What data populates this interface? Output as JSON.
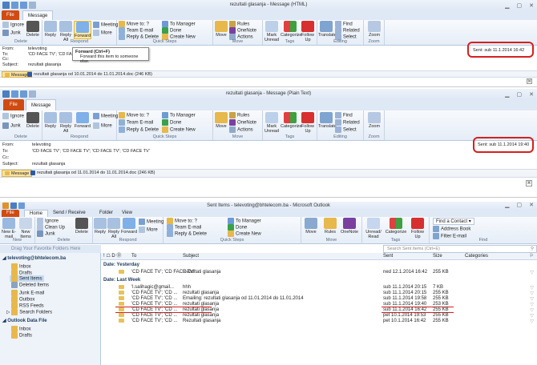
{
  "win1": {
    "title": "rezultati glasanja - Message (HTML)",
    "tabs": [
      "File",
      "Message"
    ],
    "groups": {
      "delete": {
        "label": "Delete",
        "ignore": "Ignore",
        "junk": "Junk",
        "delete": "Delete"
      },
      "respond": {
        "label": "Respond",
        "reply": "Reply",
        "reply_all": "Reply All",
        "forward": "Forward",
        "meeting": "Meeting",
        "more": "More"
      },
      "quick": {
        "label": "Quick Steps",
        "move_to": "Move to: ?",
        "team_email": "Team E-mail",
        "reply_delete": "Reply & Delete",
        "to_manager": "To Manager",
        "done": "Done",
        "create_new": "Create New"
      },
      "move": {
        "label": "Move",
        "move": "Move",
        "rules": "Rules",
        "onenote": "OneNote",
        "actions": "Actions"
      },
      "tags": {
        "label": "Tags",
        "mark_unread": "Mark Unread",
        "categorize": "Categorize",
        "follow_up": "Follow Up"
      },
      "editing": {
        "label": "Editing",
        "translate": "Translate",
        "find": "Find",
        "related": "Related",
        "select": "Select"
      },
      "zoom": {
        "label": "Zoom",
        "zoom": "Zoom"
      }
    },
    "from_label": "From:",
    "from": "televoting",
    "to_label": "To:",
    "to": "'CD FACE TV'; 'CD FACE TV'",
    "cc_label": "Cc:",
    "subject_label": "Subject:",
    "subject": "rezultati glasanja",
    "sent_label": "Sent:",
    "sent": "sub 11.1.2014 16:42",
    "tooltip_title": "Forward (Ctrl+F)",
    "tooltip_desc": "Forward this item to someone else.",
    "message_tab": "Message",
    "attachment": "rezultati glasanja od 10.01.2014 do 11.01.2014.doc (246 KB)"
  },
  "win2": {
    "title": "rezultati glasanja - Message (Plain Text)",
    "tabs": [
      "File",
      "Message"
    ],
    "groups": {
      "delete": {
        "label": "Delete",
        "ignore": "Ignore",
        "junk": "Junk",
        "delete": "Delete"
      },
      "respond": {
        "label": "Respond",
        "reply": "Reply",
        "reply_all": "Reply All",
        "forward": "Forward",
        "meeting": "Meeting",
        "more": "More"
      },
      "quick": {
        "label": "Quick Steps",
        "move_to": "Move to: ?",
        "team_email": "Team E-mail",
        "reply_delete": "Reply & Delete",
        "to_manager": "To Manager",
        "done": "Done",
        "create_new": "Create New"
      },
      "move": {
        "label": "Move",
        "move": "Move",
        "rules": "Rules",
        "onenote": "OneNote",
        "actions": "Actions"
      },
      "tags": {
        "label": "Tags",
        "mark_unread": "Mark Unread",
        "categorize": "Categorize",
        "follow_up": "Follow Up"
      },
      "editing": {
        "label": "Editing",
        "translate": "Translate",
        "find": "Find",
        "related": "Related",
        "select": "Select"
      },
      "zoom": {
        "label": "Zoom",
        "zoom": "Zoom"
      }
    },
    "from_label": "From:",
    "from": "televoting",
    "to_label": "To:",
    "to": "'CD FACE TV'; 'CD FACE TV'; 'CD FACE TV'; 'CD FACE TV'",
    "cc_label": "Cc:",
    "subject_label": "Subject:",
    "subject": "rezultati glasanja",
    "sent_label": "Sent:",
    "sent": "sub 11.1.2014 19:40",
    "message_tab": "Message",
    "attachment": "rezultati glasanja od 11.01.2014 do 11.01.2014.doc (246 KB)"
  },
  "main": {
    "title": "Sent Items - televoting@bhtelecom.ba - Microsoft Outlook",
    "tabs": [
      "File",
      "Home",
      "Send / Receive",
      "Folder",
      "View"
    ],
    "groups": {
      "new": {
        "label": "New",
        "new_email": "New E-mail",
        "new_items": "New Items"
      },
      "delete": {
        "label": "Delete",
        "ignore": "Ignore",
        "clean_up": "Clean Up",
        "junk": "Junk",
        "delete": "Delete"
      },
      "respond": {
        "label": "Respond",
        "reply": "Reply",
        "reply_all": "Reply All",
        "forward": "Forward",
        "meeting": "Meeting",
        "more": "More"
      },
      "quick": {
        "label": "Quick Steps",
        "move_to": "Move to: ?",
        "team_email": "Team E-mail",
        "reply_delete": "Reply & Delete",
        "to_manager": "To Manager",
        "done": "Done",
        "create_new": "Create New"
      },
      "move": {
        "label": "Move",
        "move": "Move",
        "rules": "Rules",
        "onenote": "OneNote"
      },
      "tags": {
        "label": "Tags",
        "unread_read": "Unread/ Read",
        "categorize": "Categorize",
        "follow_up": "Follow Up"
      },
      "find": {
        "label": "Find",
        "find_contact": "Find a Contact",
        "address_book": "Address Book",
        "filter_email": "Filter E-mail"
      }
    },
    "favorites_hint": "Drag Your Favorite Folders Here",
    "search_placeholder": "Search Sent Items (Ctrl+E)",
    "nav": {
      "account": "televoting@bhtelecom.ba",
      "folders": [
        "Inbox",
        "Drafts",
        "Sent Items",
        "Deleted Items",
        "Junk E-mail",
        "Outbox",
        "RSS Feeds",
        "Search Folders"
      ],
      "data_file": "Outlook Data File",
      "data_folders": [
        "Inbox",
        "Drafts"
      ]
    },
    "columns": {
      "icons": "! ☖ D ⓪",
      "to": "To",
      "subject": "Subject",
      "sent": "Sent",
      "size": "Size",
      "categories": "Categories"
    },
    "groups_list": [
      {
        "label": "Date: Yesterday",
        "rows": [
          {
            "to": "'CD FACE TV'; 'CD FACE TV'",
            "subject": "Rezultati glasanja",
            "sent": "ned 12.1.2014 16:42",
            "size": "255 KB",
            "red": false
          }
        ]
      },
      {
        "label": "Date: Last Week",
        "rows": [
          {
            "to": "'l.salihagic@gmail...",
            "subject": "hhh",
            "sent": "sub 11.1.2014 20:15",
            "size": "7 KB",
            "red": false
          },
          {
            "to": "'CD FACE TV'; 'CD ...",
            "subject": "rezultati glasanja",
            "sent": "sub 11.1.2014 20:15",
            "size": "255 KB",
            "red": false
          },
          {
            "to": "'CD FACE TV'; 'CD ...",
            "subject": "Emailing: rezultati glasanja od 11.01.2014 do 11.01.2014",
            "sent": "sub 11.1.2014 19:58",
            "size": "255 KB",
            "red": false
          },
          {
            "to": "'CD FACE TV'; 'CD ...",
            "subject": "rezultati glasanja",
            "sent": "sub 11.1.2014 19:40",
            "size": "253 KB",
            "red": true
          },
          {
            "to": "'CD FACE TV'; 'CD ...",
            "subject": "rezultati glasanja",
            "sent": "sub 11.1.2014 16:42",
            "size": "255 KB",
            "red": true
          },
          {
            "to": "'CD FACE TV'; 'CD ...",
            "subject": "rezultati glasanja",
            "sent": "pet 10.1.2014 19:53",
            "size": "255 KB",
            "red": false
          },
          {
            "to": "'CD FACE TV'; 'CD ...",
            "subject": "Rezultati glasanja",
            "sent": "pet 10.1.2014 16:42",
            "size": "255 KB",
            "red": false
          }
        ]
      }
    ]
  }
}
